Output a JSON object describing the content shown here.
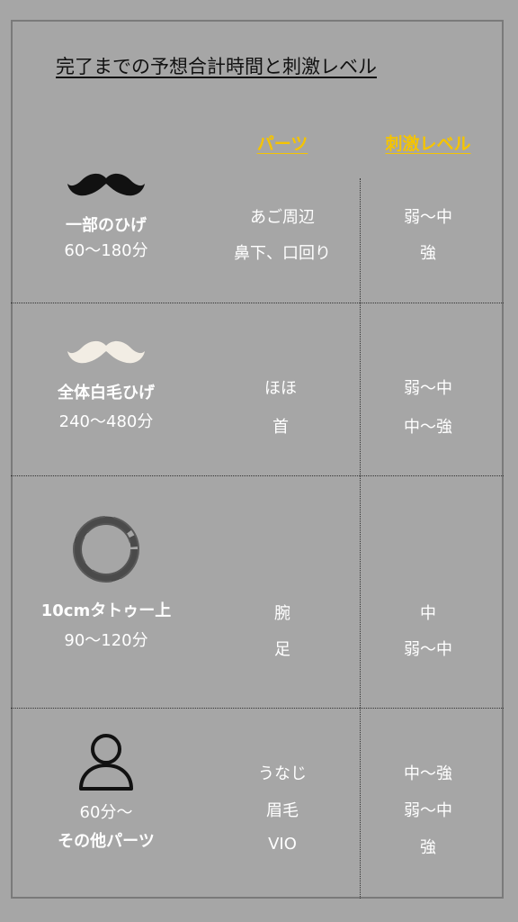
{
  "title": "完了までの予想合計時間と刺激レベル",
  "headers": {
    "parts": "パーツ",
    "level": "刺激レベル"
  },
  "colors": {
    "background": "#a6a6a6",
    "header_accent": "#f5c400",
    "text": "#ffffff"
  },
  "rows": [
    {
      "icon": "mustache-black-icon",
      "name": "一部のひげ",
      "time": "60〜180分",
      "parts": [
        "あご周辺",
        "鼻下、口回り"
      ],
      "levels": [
        "弱〜中",
        "強"
      ]
    },
    {
      "icon": "mustache-white-icon",
      "name": "全体白毛ひげ",
      "time": "240〜480分",
      "parts": [
        "ほほ",
        "首"
      ],
      "levels": [
        "弱〜中",
        "中〜強"
      ]
    },
    {
      "icon": "brush-circle-icon",
      "name": "10cmタトゥー上",
      "time": "90〜120分",
      "parts": [
        "腕",
        "足"
      ],
      "levels": [
        "中",
        "弱〜中"
      ]
    },
    {
      "icon": "person-icon",
      "name": "その他パーツ",
      "time": "60分〜",
      "parts": [
        "うなじ",
        "眉毛",
        "VIO"
      ],
      "levels": [
        "中〜強",
        "弱〜中",
        "強"
      ]
    }
  ]
}
